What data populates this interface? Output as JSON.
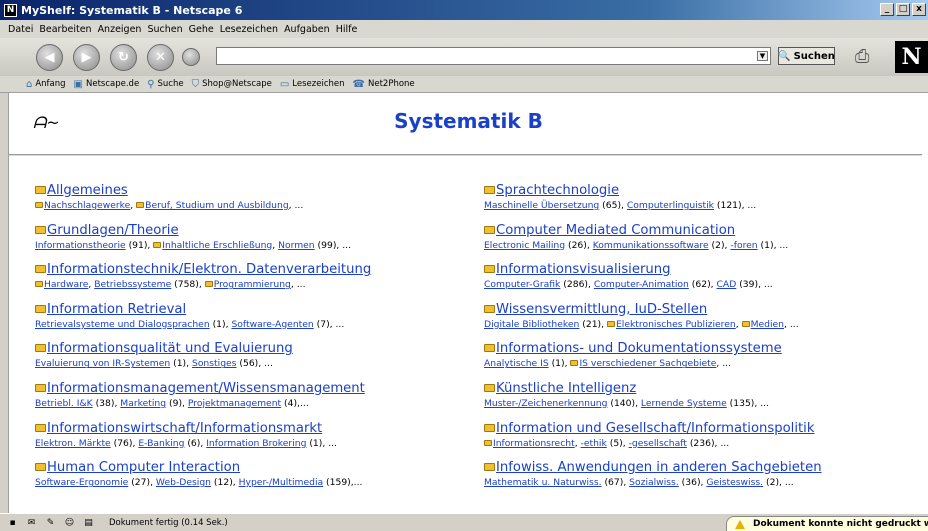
{
  "window": {
    "title": "MyShelf: Systematik B - Netscape 6",
    "logo": "N",
    "controls": [
      "_",
      "□",
      "x"
    ]
  },
  "menu": [
    "Datei",
    "Bearbeiten",
    "Anzeigen",
    "Suchen",
    "Gehe",
    "Lesezeichen",
    "Aufgaben",
    "Hilfe"
  ],
  "toolbar": {
    "url_value": "",
    "search_label": "Suchen",
    "netscape_logo": "N"
  },
  "personal_toolbar": [
    {
      "label": "Anfang",
      "icon": "home-icon"
    },
    {
      "label": "Netscape.de",
      "icon": "my-icon"
    },
    {
      "label": "Suche",
      "icon": "search-icon"
    },
    {
      "label": "Shop@Netscape",
      "icon": "shop-icon"
    },
    {
      "label": "Lesezeichen",
      "icon": "bookmark-icon"
    },
    {
      "label": "Net2Phone",
      "icon": "phone-icon"
    }
  ],
  "page": {
    "title": "Systematik B",
    "signature": "ᗩ~"
  },
  "categories_left": [
    {
      "title": "Allgemeines",
      "sub": [
        {
          "text": "Nachschlagewerke",
          "link": true,
          "folder": true
        },
        {
          "text": ", ",
          "link": false
        },
        {
          "text": "Beruf, Studium und Ausbildung",
          "link": true,
          "folder": true
        },
        {
          "text": ", ...",
          "link": false
        }
      ]
    },
    {
      "title": "Grundlagen/Theorie",
      "sub": [
        {
          "text": "Informationstheorie",
          "link": true
        },
        {
          "text": " (91), ",
          "link": false
        },
        {
          "text": "Inhaltliche Erschließung",
          "link": true,
          "folder": true
        },
        {
          "text": ", ",
          "link": false
        },
        {
          "text": "Normen",
          "link": true
        },
        {
          "text": " (99), ...",
          "link": false
        }
      ]
    },
    {
      "title": "Informationstechnik/Elektron. Datenverarbeitung",
      "sub": [
        {
          "text": "Hardware",
          "link": true,
          "folder": true
        },
        {
          "text": ", ",
          "link": false
        },
        {
          "text": "Betriebssysteme",
          "link": true
        },
        {
          "text": " (758), ",
          "link": false
        },
        {
          "text": "Programmierung",
          "link": true,
          "folder": true
        },
        {
          "text": ", ...",
          "link": false
        }
      ]
    },
    {
      "title": "Information Retrieval",
      "sub": [
        {
          "text": "Retrievalsysteme und Dialogsprachen",
          "link": true
        },
        {
          "text": " (1), ",
          "link": false
        },
        {
          "text": "Software-Agenten",
          "link": true
        },
        {
          "text": " (7), ...",
          "link": false
        }
      ]
    },
    {
      "title": "Informationsqualität und Evaluierung",
      "sub": [
        {
          "text": "Evaluierung von IR-Systemen",
          "link": true
        },
        {
          "text": " (1), ",
          "link": false
        },
        {
          "text": "Sonstiges",
          "link": true
        },
        {
          "text": " (56), ...",
          "link": false
        }
      ]
    },
    {
      "title": "Informationsmanagement/Wissensmanagement",
      "sub": [
        {
          "text": "Betriebl. I&K",
          "link": true
        },
        {
          "text": " (38), ",
          "link": false
        },
        {
          "text": "Marketing",
          "link": true
        },
        {
          "text": " (9), ",
          "link": false
        },
        {
          "text": "Projektmanagement",
          "link": true
        },
        {
          "text": " (4),...",
          "link": false
        }
      ]
    },
    {
      "title": "Informationswirtschaft/Informationsmarkt",
      "sub": [
        {
          "text": "Elektron. Märkte",
          "link": true
        },
        {
          "text": " (76), ",
          "link": false
        },
        {
          "text": "E-Banking",
          "link": true
        },
        {
          "text": " (6), ",
          "link": false
        },
        {
          "text": "Information Brokering",
          "link": true
        },
        {
          "text": " (1), ...",
          "link": false
        }
      ]
    },
    {
      "title": "Human Computer Interaction",
      "sub": [
        {
          "text": "Software-Ergonomie",
          "link": true
        },
        {
          "text": " (27), ",
          "link": false
        },
        {
          "text": "Web-Design",
          "link": true
        },
        {
          "text": " (12), ",
          "link": false
        },
        {
          "text": "Hyper-/Multimedia",
          "link": true
        },
        {
          "text": " (159),...",
          "link": false
        }
      ]
    }
  ],
  "categories_right": [
    {
      "title": "Sprachtechnologie",
      "sub": [
        {
          "text": "Maschinelle Übersetzung",
          "link": true
        },
        {
          "text": " (65), ",
          "link": false
        },
        {
          "text": "Computerlinguistik",
          "link": true
        },
        {
          "text": " (121), ...",
          "link": false
        }
      ]
    },
    {
      "title": "Computer Mediated Communication",
      "sub": [
        {
          "text": "Electronic Mailing",
          "link": true
        },
        {
          "text": " (26), ",
          "link": false
        },
        {
          "text": "Kommunikationssoftware",
          "link": true
        },
        {
          "text": " (2), ",
          "link": false
        },
        {
          "text": "-foren",
          "link": true
        },
        {
          "text": " (1), ...",
          "link": false
        }
      ]
    },
    {
      "title": "Informationsvisualisierung",
      "sub": [
        {
          "text": "Computer-Grafik",
          "link": true
        },
        {
          "text": " (286), ",
          "link": false
        },
        {
          "text": "Computer-Animation",
          "link": true
        },
        {
          "text": " (62), ",
          "link": false
        },
        {
          "text": "CAD",
          "link": true
        },
        {
          "text": " (39), ...",
          "link": false
        }
      ]
    },
    {
      "title": "Wissensvermittlung, IuD-Stellen",
      "sub": [
        {
          "text": "Digitale Bibliotheken",
          "link": true
        },
        {
          "text": " (21), ",
          "link": false
        },
        {
          "text": "Elektronisches Publizieren",
          "link": true,
          "folder": true
        },
        {
          "text": ", ",
          "link": false
        },
        {
          "text": "Medien",
          "link": true,
          "folder": true
        },
        {
          "text": ", ...",
          "link": false
        }
      ]
    },
    {
      "title": "Informations- und Dokumentationssysteme",
      "sub": [
        {
          "text": "Analytische IS",
          "link": true
        },
        {
          "text": " (1), ",
          "link": false
        },
        {
          "text": "IS verschiedener Sachgebiete",
          "link": true,
          "folder": true
        },
        {
          "text": ", ...",
          "link": false
        }
      ]
    },
    {
      "title": "Künstliche Intelligenz",
      "sub": [
        {
          "text": "Muster-/Zeichenerkennung",
          "link": true
        },
        {
          "text": " (140), ",
          "link": false
        },
        {
          "text": "Lernende Systeme",
          "link": true
        },
        {
          "text": " (135), ...",
          "link": false
        }
      ]
    },
    {
      "title": "Information und Gesellschaft/Informationspolitik",
      "sub": [
        {
          "text": "Informationsrecht",
          "link": true,
          "folder": true
        },
        {
          "text": ", ",
          "link": false
        },
        {
          "text": "-ethik",
          "link": true
        },
        {
          "text": " (5), ",
          "link": false
        },
        {
          "text": "-gesellschaft",
          "link": true
        },
        {
          "text": " (236), ...",
          "link": false
        }
      ]
    },
    {
      "title": "Infowiss. Anwendungen in anderen Sachgebieten",
      "sub": [
        {
          "text": "Mathematik u. Naturwiss.",
          "link": true
        },
        {
          "text": " (67), ",
          "link": false
        },
        {
          "text": "Sozialwiss.",
          "link": true
        },
        {
          "text": " (36), ",
          "link": false
        },
        {
          "text": "Geisteswiss.",
          "link": true
        },
        {
          "text": " (2), ...",
          "link": false
        }
      ]
    }
  ],
  "status": {
    "text": "Dokument fertig (0.14 Sek.)",
    "alert": "Dokument konnte nicht gedruckt werde"
  },
  "colors": {
    "link": "#1a3fc8",
    "folder": "#f0c030"
  }
}
